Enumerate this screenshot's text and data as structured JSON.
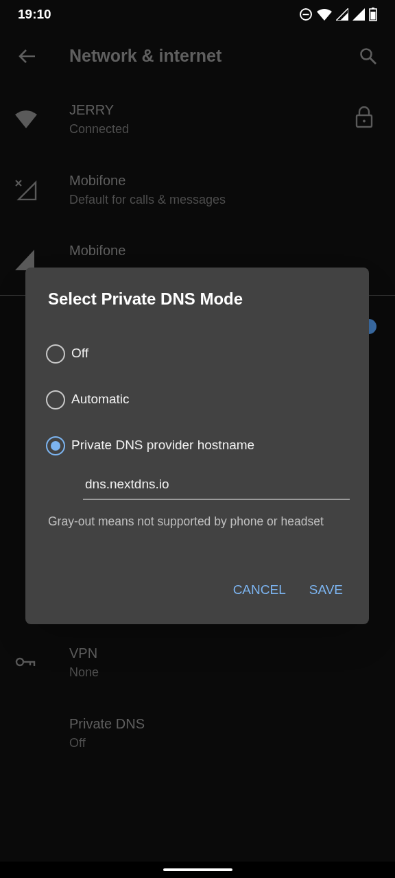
{
  "status_bar": {
    "time": "19:10"
  },
  "toolbar": {
    "title": "Network & internet"
  },
  "items": [
    {
      "kind": "wifi",
      "title": "JERRY",
      "subtitle": "Connected",
      "locked": true
    },
    {
      "kind": "sim_off",
      "title": "Mobifone",
      "subtitle": "Default for calls & messages"
    },
    {
      "kind": "signal",
      "title": "Mobifone"
    },
    {
      "kind": "toggle",
      "on": true
    },
    {
      "kind": "vpn",
      "title": "VPN",
      "subtitle": "None"
    },
    {
      "kind": "plain",
      "title": "Private DNS",
      "subtitle": "Off"
    }
  ],
  "dialog": {
    "title": "Select Private DNS Mode",
    "options": [
      {
        "label": "Off",
        "selected": false
      },
      {
        "label": "Automatic",
        "selected": false
      },
      {
        "label": "Private DNS provider hostname",
        "selected": true
      }
    ],
    "hostname": "dns.nextdns.io",
    "note": "Gray-out means not supported by phone or headset",
    "buttons": [
      "CANCEL",
      "SAVE"
    ]
  }
}
